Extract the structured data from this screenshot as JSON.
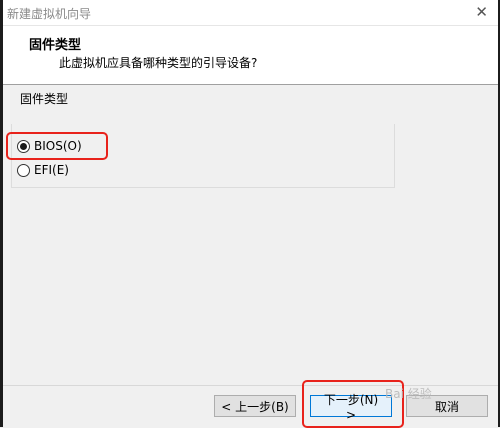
{
  "window": {
    "title": "新建虚拟机向导"
  },
  "header": {
    "title": "固件类型",
    "subtitle": "此虚拟机应具备哪种类型的引导设备?"
  },
  "firmware_group": {
    "label": "固件类型",
    "options": [
      {
        "label": "BIOS(O)",
        "selected": true
      },
      {
        "label": "EFI(E)",
        "selected": false
      }
    ]
  },
  "buttons": {
    "back": "< 上一步(B)",
    "next": "下一步(N) >",
    "cancel": "取消"
  },
  "watermark": "Bai 经验",
  "colors": {
    "highlight": "#e8221b",
    "default_button_border": "#0078d7"
  }
}
